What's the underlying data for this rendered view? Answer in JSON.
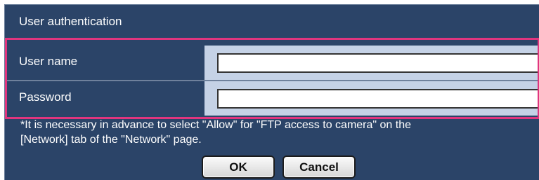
{
  "dialog": {
    "title": "User authentication"
  },
  "fields": {
    "username": {
      "label": "User name",
      "value": ""
    },
    "password": {
      "label": "Password",
      "value": ""
    }
  },
  "note": {
    "line1": "*It is necessary in advance to select \"Allow\" for \"FTP access to camera\" on the",
    "line2": "[Network] tab of the \"Network\" page."
  },
  "buttons": {
    "ok": "OK",
    "cancel": "Cancel"
  },
  "colors": {
    "panel_background": "#2b4468",
    "input_cell_background": "#c5d2e6",
    "highlight_border": "#e0357e"
  }
}
